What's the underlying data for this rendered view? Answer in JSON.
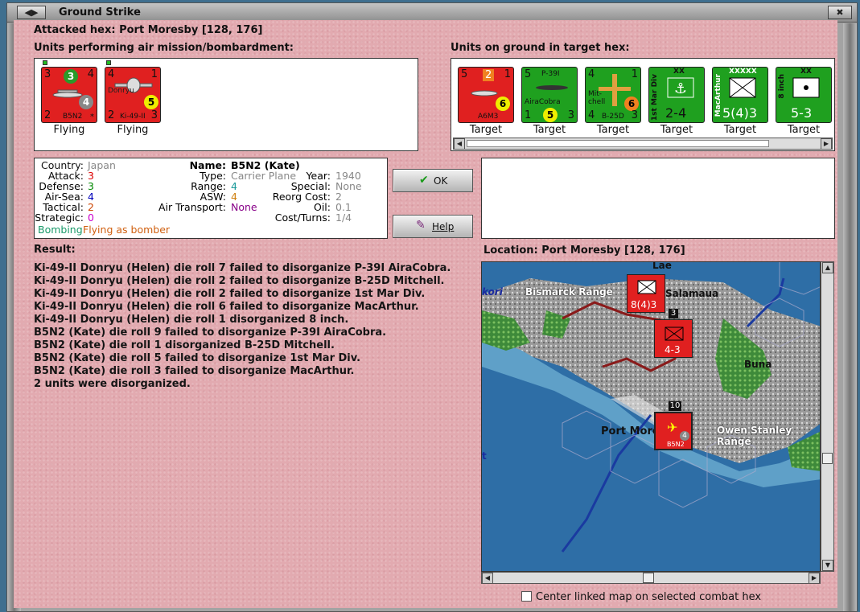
{
  "window": {
    "title": "Ground Strike"
  },
  "header": {
    "attacked_hex": "Attacked hex: Port Moresby  [128, 176]"
  },
  "air_units": {
    "label": "Units performing air mission/bombardment:",
    "units": [
      {
        "name": "B5N2",
        "status": "Flying",
        "tl": "3",
        "tc": "3",
        "tr": "4",
        "bl": "2",
        "br": "4",
        "badge": "4"
      },
      {
        "name": "Ki-49-II",
        "nick": "Donryu",
        "status": "Flying",
        "tl": "4",
        "tr": "1",
        "bl": "2",
        "br": "3",
        "badge": "5"
      }
    ]
  },
  "ground_units": {
    "label": "Units on ground in target hex:",
    "units": [
      {
        "name": "A6M3",
        "status": "Target",
        "tl": "5",
        "tc": "2",
        "tr": "1",
        "bl": "2",
        "br": "3",
        "badge": "6"
      },
      {
        "name": "P-39I",
        "sub": "AiraCobra",
        "status": "Target",
        "tl": "5",
        "tr": "1",
        "bl": "1",
        "br": "3",
        "badge": "5"
      },
      {
        "name": "B-25D",
        "sub": "Mit-chell",
        "status": "Target",
        "tl": "4",
        "tr": "1",
        "bl": "4",
        "br": "3",
        "badge": "6"
      },
      {
        "name": "1st Mar Div",
        "size": "XX",
        "value": "2-4",
        "status": "Target"
      },
      {
        "name": "MacArthur",
        "size": "XXXXX",
        "value": "5(4)3",
        "status": "Target"
      },
      {
        "name": "8 inch",
        "size": "XX",
        "value": "5-3",
        "status": "Target"
      }
    ]
  },
  "details": {
    "country_k": "Country:",
    "country": "Japan",
    "attack_k": "Attack:",
    "attack": "3",
    "defense_k": "Defense:",
    "defense": "3",
    "airsea_k": "Air-Sea:",
    "airsea": "4",
    "tactical_k": "Tactical:",
    "tactical": "2",
    "strategic_k": "Strategic:",
    "strategic": "0",
    "mode1": "Bombing",
    "mode2": "Flying as bomber",
    "name_k": "Name:",
    "name": "B5N2 (Kate)",
    "type_k": "Type:",
    "type": "Carrier Plane",
    "range_k": "Range:",
    "range": "4",
    "asw_k": "ASW:",
    "asw": "4",
    "airtrans_k": "Air Transport:",
    "airtrans": "None",
    "year_k": "Year:",
    "year": "1940",
    "special_k": "Special:",
    "special": "None",
    "reorg_k": "Reorg Cost:",
    "reorg": "2",
    "oil_k": "Oil:",
    "oil": "0.1",
    "cost_k": "Cost/Turns:",
    "cost": "1/4"
  },
  "buttons": {
    "ok": "OK",
    "help": "Help"
  },
  "result": {
    "label": "Result:",
    "lines": [
      "Ki-49-II Donryu (Helen) die roll 7 failed to disorganize P-39I AiraCobra.",
      "Ki-49-II Donryu (Helen) die roll 2 failed to disorganize B-25D Mitchell.",
      "Ki-49-II Donryu (Helen) die roll 2 failed to disorganize 1st Mar Div.",
      "Ki-49-II Donryu (Helen) die roll 6 failed to disorganize MacArthur.",
      "Ki-49-II Donryu (Helen) die roll 1 disorganized 8 inch.",
      "B5N2 (Kate) die roll 9 failed to disorganize P-39I AiraCobra.",
      "B5N2 (Kate) die roll 1 disorganized B-25D Mitchell.",
      "B5N2 (Kate) die roll 5 failed to disorganize 1st Mar Div.",
      "B5N2 (Kate) die roll 3 failed to disorganize MacArthur.",
      "2 units were disorganized."
    ]
  },
  "location": {
    "label": "Location:  Port Moresby  [128, 176]"
  },
  "map": {
    "places": [
      "Lae",
      "Bismarck Range",
      "Salamaua",
      "Buna",
      "Port Moresby",
      "Owen Stanley Range",
      "kori",
      "t"
    ],
    "stack1": "8(4)3",
    "stack2": "4-3",
    "stack2_count": "3",
    "stack3_count": "10",
    "stack3_name": "B5N2",
    "stack3_badge": "4"
  },
  "footer": {
    "center_checkbox": "Center linked map on selected combat hex"
  },
  "colors": {
    "pink": "#e2aab0",
    "red_counter": "#e02020",
    "green_counter": "#1fa01f"
  }
}
